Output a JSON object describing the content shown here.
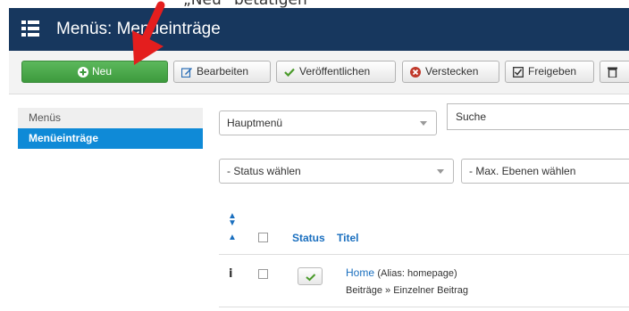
{
  "caption": {
    "text": "„Neu“ betätigen"
  },
  "header": {
    "title": "Menüs: Menüeinträge"
  },
  "toolbar": {
    "new_label": "Neu",
    "edit_label": "Bearbeiten",
    "publish_label": "Veröffentlichen",
    "unpublish_label": "Verstecken",
    "checkin_label": "Freigeben"
  },
  "sidebar": {
    "items": [
      {
        "label": "Menüs",
        "active": false
      },
      {
        "label": "Menüeinträge",
        "active": true
      }
    ]
  },
  "filters": {
    "menu_select": "Hauptmenü",
    "search_placeholder": "Suche",
    "status_select": "- Status wählen",
    "levels_select": "- Max. Ebenen wählen"
  },
  "table": {
    "headers": {
      "status": "Status",
      "title": "Titel"
    },
    "rows": [
      {
        "title": "Home",
        "alias": "(Alias: homepage)",
        "path": "Beiträge » Einzelner Beitrag",
        "published": true
      }
    ]
  },
  "colors": {
    "header_bg": "#17375e",
    "new_button": "#4caf50",
    "active_sidebar": "#0f8ad7",
    "arrow": "#e41e1e"
  }
}
